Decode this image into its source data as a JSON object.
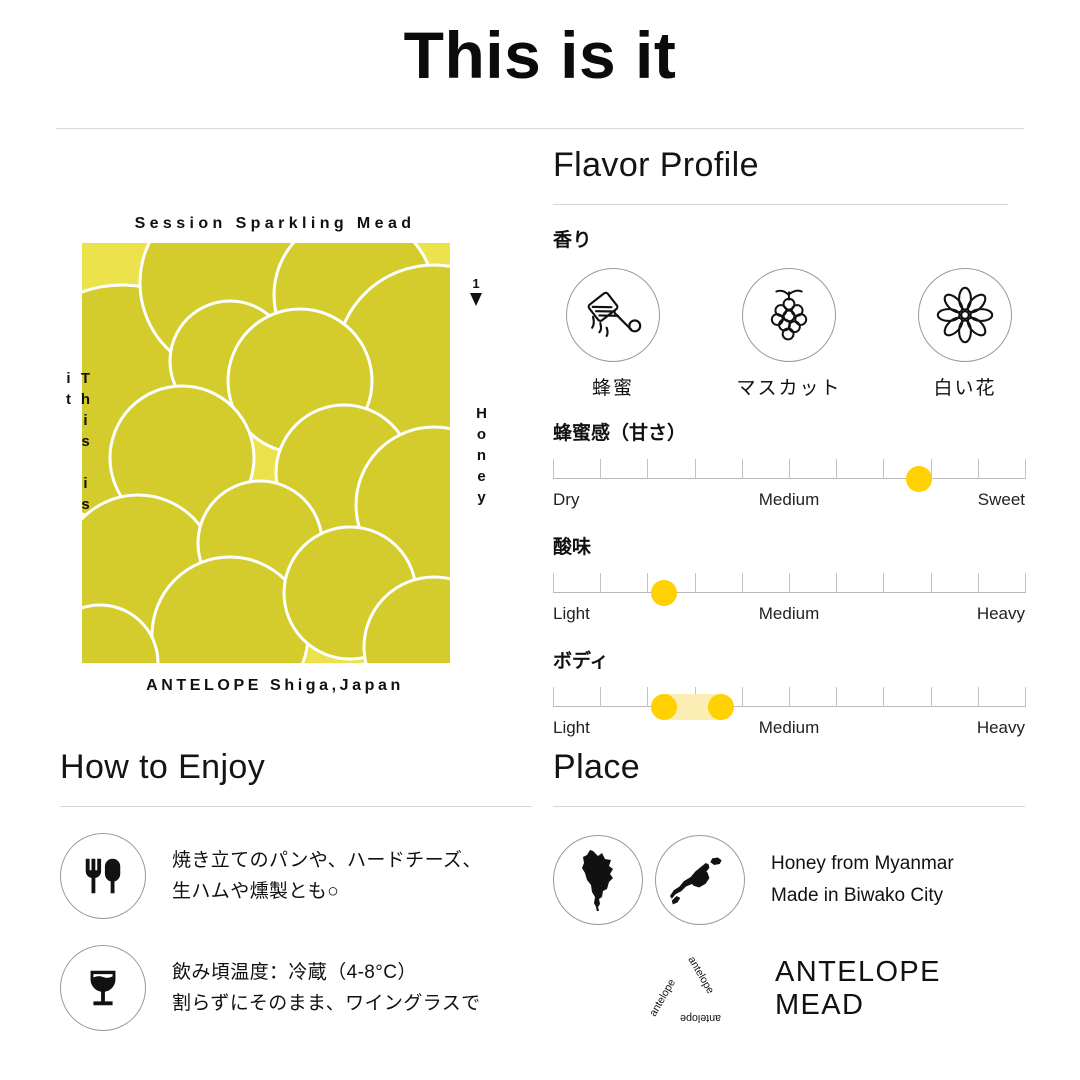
{
  "header": {
    "title": "This is it"
  },
  "label": {
    "top_text": "Session Sparkling Mead",
    "bottom_text": "ANTELOPE  Shiga,Japan",
    "left_text": "This is it",
    "right_text": "Honey",
    "mark_number": "1",
    "colors": {
      "base": "#ECE24C",
      "circles": "#D4CB2C",
      "outline": "#FFFFFF"
    }
  },
  "flavor": {
    "section_title": "Flavor Profile",
    "aroma_label": "香り",
    "aromas": [
      {
        "icon": "honey-dipper-icon",
        "name": "蜂蜜"
      },
      {
        "icon": "grapes-icon",
        "name": "マスカット"
      },
      {
        "icon": "flower-icon",
        "name": "白い花"
      }
    ],
    "sliders": [
      {
        "title": "蜂蜜感（甘さ）",
        "left_label": "Dry",
        "mid_label": "Medium",
        "right_label": "Sweet",
        "ticks": 11,
        "type": "single",
        "value": 0.775
      },
      {
        "title": "酸味",
        "left_label": "Light",
        "mid_label": "Medium",
        "right_label": "Heavy",
        "ticks": 11,
        "type": "single",
        "value": 0.235
      },
      {
        "title": "ボディ",
        "left_label": "Light",
        "mid_label": "Medium",
        "right_label": "Heavy",
        "ticks": 11,
        "type": "range",
        "value_start": 0.235,
        "value_end": 0.355
      }
    ],
    "dot_color": "#FFD100",
    "range_color": "#FBEDB4"
  },
  "enjoy": {
    "section_title": "How to Enjoy",
    "items": [
      {
        "icon": "fork-spoon-icon",
        "line1": "焼き立てのパンや、ハードチーズ、",
        "line2": "生ハムや燻製とも○"
      },
      {
        "icon": "wine-glass-icon",
        "line1": "飲み頃温度：冷蔵（4-8°C）",
        "line2": "割らずにそのまま、ワイングラスで"
      }
    ]
  },
  "place": {
    "section_title": "Place",
    "maps": [
      {
        "icon": "myanmar-map-icon"
      },
      {
        "icon": "japan-map-icon"
      }
    ],
    "line1": "Honey from Myanmar",
    "line2": "Made in Biwako City",
    "brand_logo_word": "antelope",
    "brand_name": "ANTELOPE MEAD"
  }
}
